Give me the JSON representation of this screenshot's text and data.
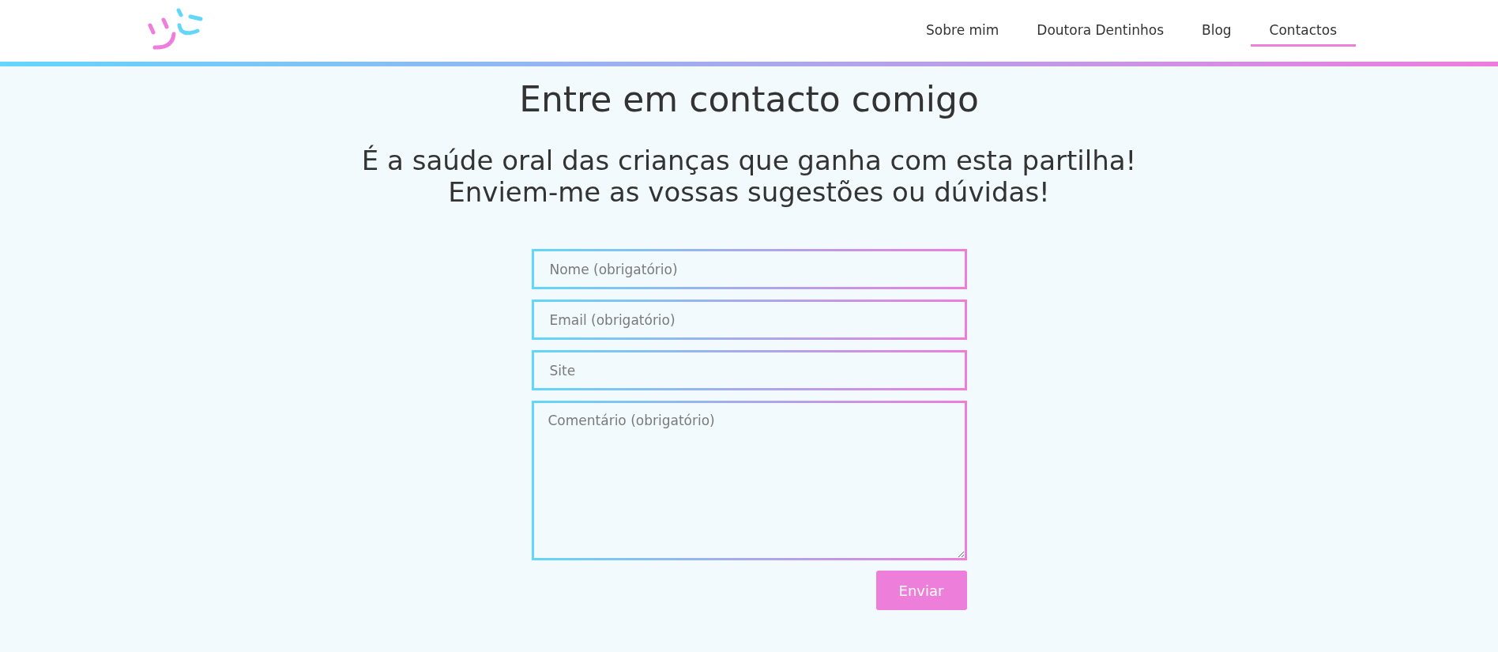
{
  "nav": {
    "items": [
      {
        "label": "Sobre mim",
        "selected": false
      },
      {
        "label": "Doutora Dentinhos",
        "selected": false
      },
      {
        "label": "Blog",
        "selected": false
      },
      {
        "label": "Contactos",
        "selected": true
      }
    ]
  },
  "heading": "Entre em contacto comigo",
  "subheading": [
    "É a saúde oral das crianças que ganha com esta partilha!",
    "Enviem-me as vossas sugestões ou dúvidas!"
  ],
  "form": {
    "fields": [
      {
        "kind": "input",
        "placeholder": "Nome (obrigatório)"
      },
      {
        "kind": "input",
        "placeholder": "Email (obrigatório)"
      },
      {
        "kind": "input",
        "placeholder": "Site"
      },
      {
        "kind": "textarea",
        "placeholder": "Comentário (obrigatório)"
      }
    ],
    "submit": "Enviar"
  }
}
